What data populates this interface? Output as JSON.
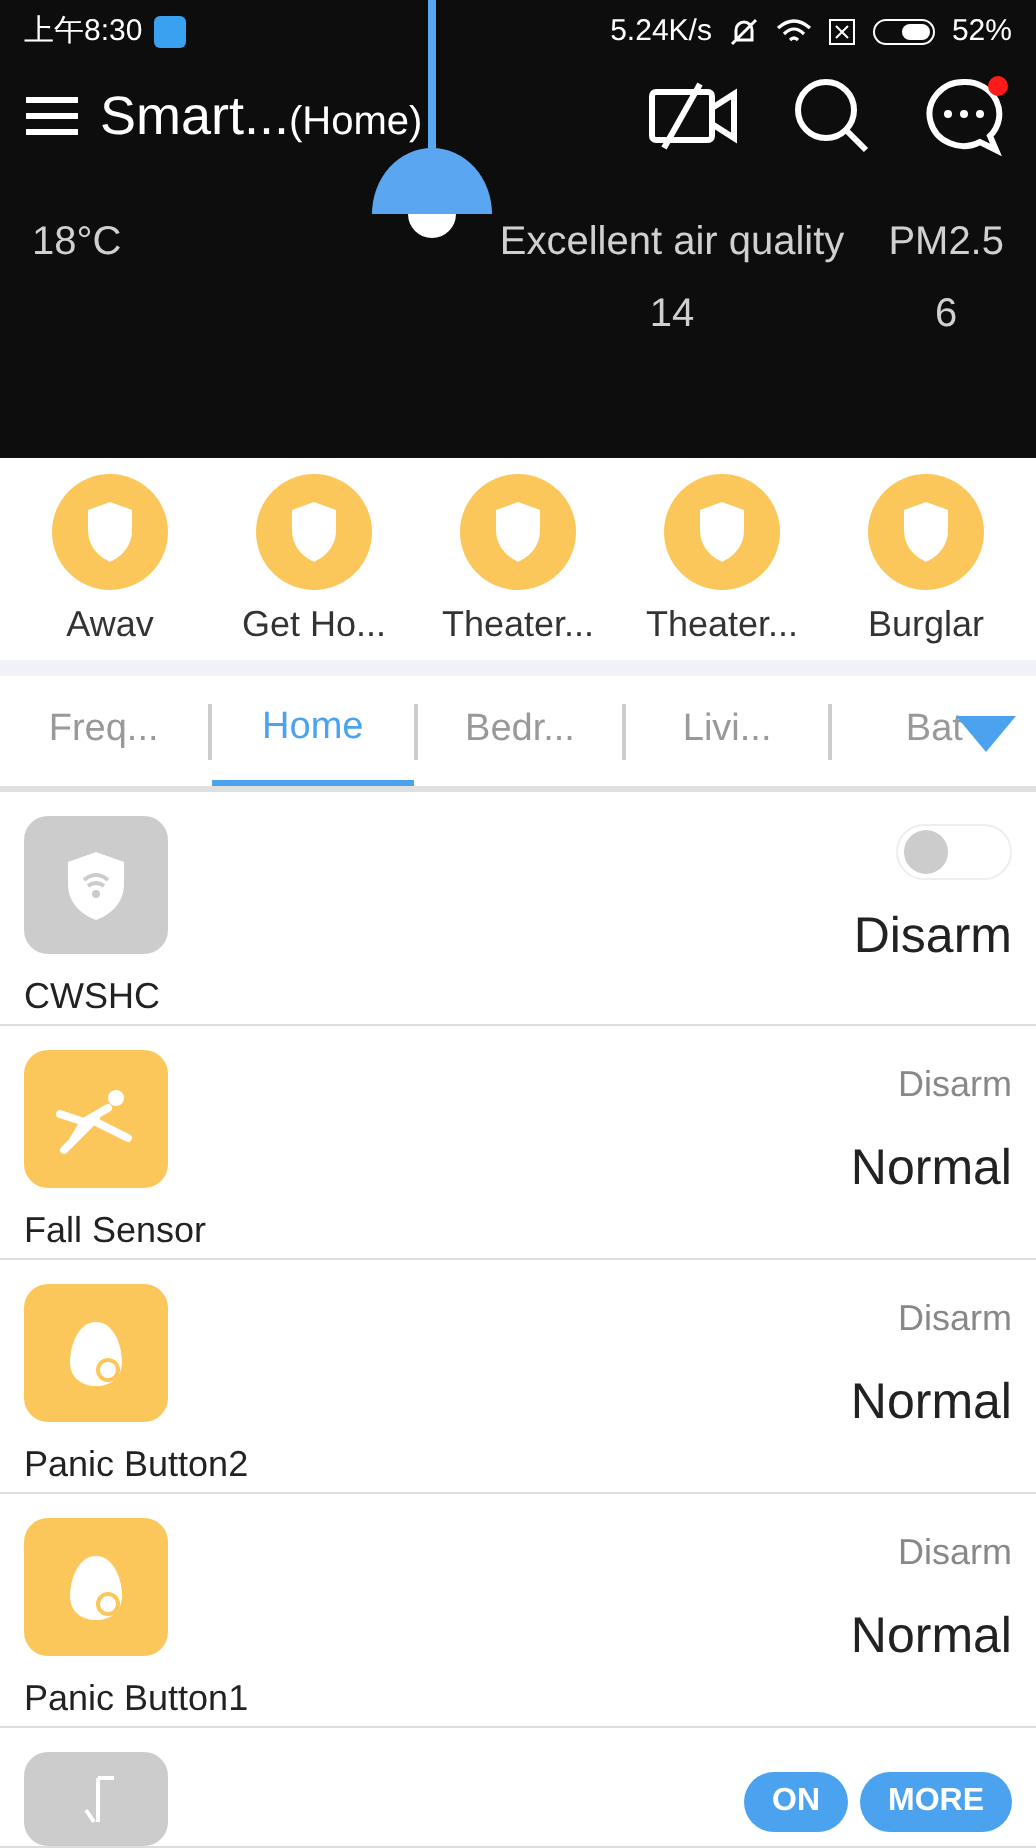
{
  "status_bar": {
    "time": "上午8:30",
    "speed": "5.24K/s",
    "battery": "52%"
  },
  "header": {
    "title": "Smart...",
    "subtitle": "(Home)",
    "has_notification": true
  },
  "weather": {
    "temperature": "18°C",
    "air_label": "Excellent air quality",
    "air_value": "14",
    "pm_label": "PM2.5",
    "pm_value": "6"
  },
  "scenes": [
    {
      "label": "Awav"
    },
    {
      "label": "Get Ho..."
    },
    {
      "label": "Theater..."
    },
    {
      "label": "Theater..."
    },
    {
      "label": "Burglar"
    }
  ],
  "tabs": [
    {
      "label": "Freq...",
      "selected": false
    },
    {
      "label": "Home",
      "selected": true
    },
    {
      "label": "Bedr...",
      "selected": false
    },
    {
      "label": "Livi...",
      "selected": false
    },
    {
      "label": "Bat",
      "selected": false
    }
  ],
  "devices": [
    {
      "kind": "gateway",
      "name": "CWSHC",
      "color": "#cccccc",
      "on": false,
      "status": "Disarm"
    },
    {
      "kind": "fall_sensor",
      "name": "Fall Sensor",
      "color": "#fcc75a",
      "mode": "Disarm",
      "status": "Normal"
    },
    {
      "kind": "panic_button",
      "name": "Panic Button2",
      "color": "#fcc75a",
      "mode": "Disarm",
      "status": "Normal"
    },
    {
      "kind": "panic_button",
      "name": "Panic Button1",
      "color": "#fcc75a",
      "mode": "Disarm",
      "status": "Normal"
    },
    {
      "kind": "switch",
      "color": "#cccccc",
      "buttons": [
        "ON",
        "MORE"
      ]
    }
  ]
}
